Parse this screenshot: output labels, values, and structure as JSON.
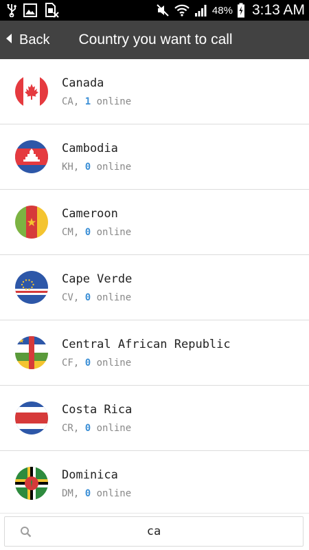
{
  "status_bar": {
    "battery_percent": "48%",
    "time": "3:13 AM",
    "icons": [
      "usb-icon",
      "image-icon",
      "sim-off-icon",
      "mute-icon",
      "wifi-icon",
      "signal-icon",
      "battery-charging-icon"
    ]
  },
  "action_bar": {
    "back_label": "Back",
    "title": "Country you want to call"
  },
  "countries": [
    {
      "name": "Canada",
      "code": "CA",
      "count": "1",
      "suffix": " online",
      "sep": ", "
    },
    {
      "name": "Cambodia",
      "code": "KH",
      "count": "0",
      "suffix": " online",
      "sep": ", "
    },
    {
      "name": "Cameroon",
      "code": "CM",
      "count": "0",
      "suffix": " online",
      "sep": ", "
    },
    {
      "name": "Cape Verde",
      "code": "CV",
      "count": "0",
      "suffix": " online",
      "sep": ", "
    },
    {
      "name": "Central African Republic",
      "code": "CF",
      "count": "0",
      "suffix": " online",
      "sep": ", "
    },
    {
      "name": "Costa Rica",
      "code": "CR",
      "count": "0",
      "suffix": " online",
      "sep": ", "
    },
    {
      "name": "Dominica",
      "code": "DM",
      "count": "0",
      "suffix": " online",
      "sep": ", "
    }
  ],
  "search": {
    "value": "ca",
    "icon": "search-icon"
  },
  "colors": {
    "action_bar": "#424242",
    "online_count": "#3b8fd6"
  }
}
